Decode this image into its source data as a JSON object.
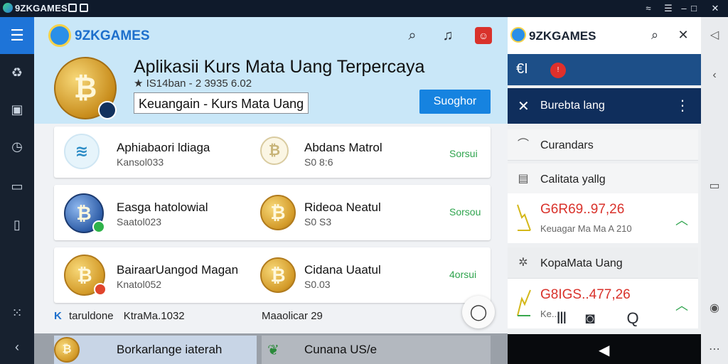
{
  "titlebar": {
    "brand": "9ZKGAMES",
    "icons": [
      "logo-icon",
      "lock-icon",
      "bookmark-icon"
    ],
    "controls": [
      "wifi-icon",
      "hamburger-icon",
      "minimize-icon",
      "maximize-icon",
      "close-icon"
    ]
  },
  "rail": {
    "icons": [
      "menu-icon",
      "recycle-icon",
      "document-icon",
      "clock-icon",
      "square-icon",
      "building-icon",
      "dots-icon",
      "share-icon"
    ]
  },
  "main": {
    "brand": "9ZKGAMES",
    "header_icons": [
      "search-icon",
      "bell-icon",
      "profile-icon"
    ],
    "app": {
      "title": "Aplikasii Kurs Mata Uang Terpercaya",
      "meta": "★ IS14ban - 2 3935 6.02",
      "category": "Keuangain  -  Kurs Mata Uang",
      "install_label": "Suoghor"
    },
    "cards": [
      {
        "left_title": "Aphiabaori ldiaga",
        "left_sub": "Kansol033",
        "right_title": "Abdans Matrol",
        "right_sub": "S0 8:6",
        "action": "Sorsui"
      },
      {
        "left_title": "Easga hatolowial",
        "left_sub": "Saatol023",
        "right_title": "Rideoa Neatul",
        "right_sub": "S0 S3",
        "action": "Sorsou"
      },
      {
        "left_title": "BairaarUangod Magan",
        "left_sub": "Knatol052",
        "right_title": "Cidana Uaatul",
        "right_sub": "S0.03",
        "action": "4orsui"
      }
    ],
    "loose_row": {
      "prefix": "K",
      "a": "taruldone",
      "b": "KtraMa.1032",
      "c": "Maaolicar 29"
    },
    "bottom_tabs": [
      "Borkarlange iaterah",
      "Cunana US/e"
    ]
  },
  "right_pane": {
    "brand": "9ZKGAMES",
    "blue_bar_badge": "!",
    "nav_title": "Burebta lang",
    "rows": [
      {
        "label": "Curandars",
        "icon": "wrench-icon"
      },
      {
        "label": "Calitata yallg",
        "icon": "wallet-icon"
      }
    ],
    "rate1": {
      "value": "G6R69..97,26",
      "sub": "Keuagar Ma Ma A 210"
    },
    "row3": {
      "label": "KopaMata Uang",
      "icon": "gear-icon"
    },
    "rate2": {
      "value": "G8IGS..477,26",
      "sub": "Ke..."
    }
  },
  "right_rail": {
    "icons": [
      "mute-icon",
      "back-icon",
      "square-icon",
      "circle-icon",
      "more-icon"
    ]
  }
}
